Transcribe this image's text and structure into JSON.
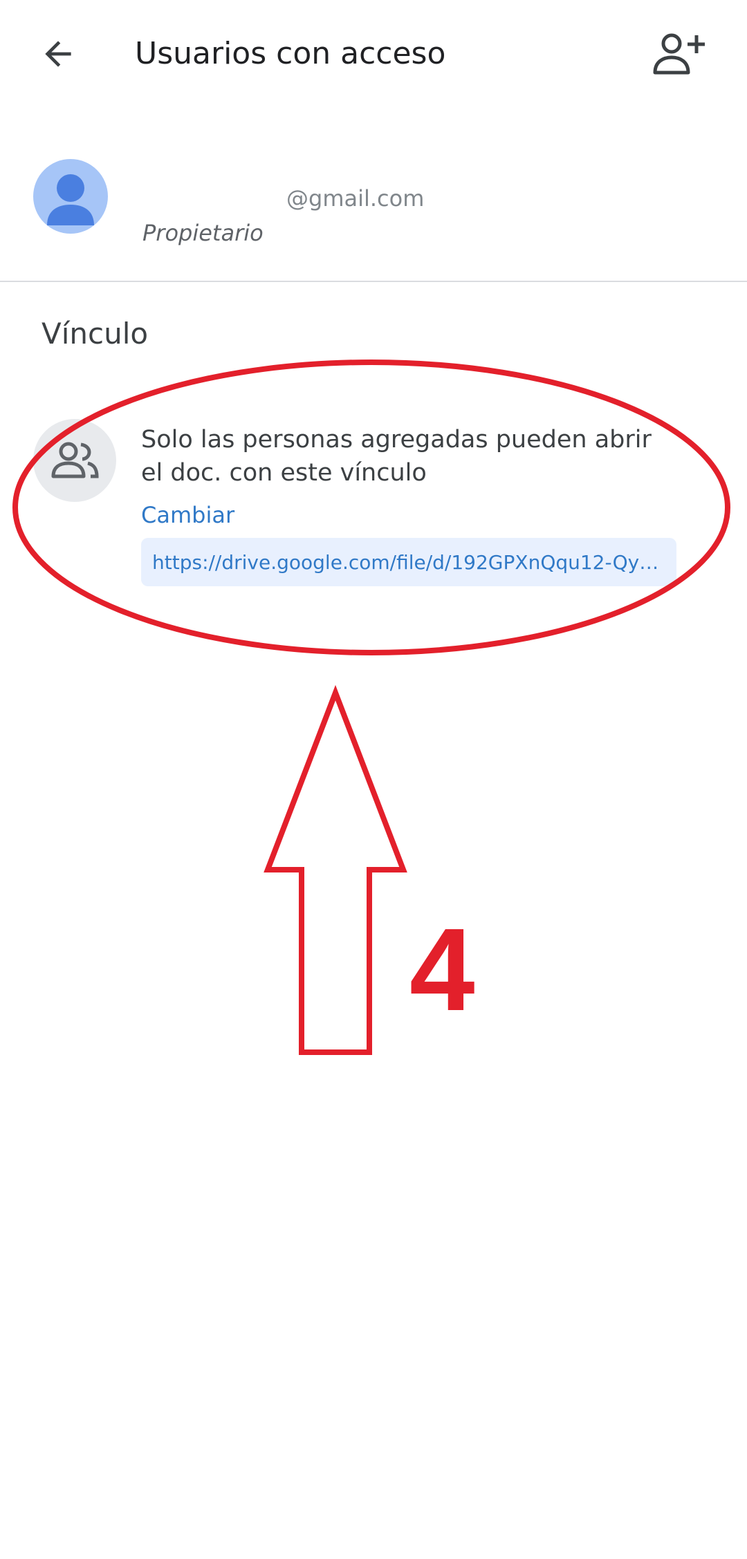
{
  "app_bar": {
    "back_icon": "arrow-left-icon",
    "title": "Usuarios con acceso",
    "add_person_icon": "person-add-icon"
  },
  "owner": {
    "avatar_icon": "person-avatar-icon",
    "email": "@gmail.com",
    "role": "Propietario"
  },
  "link_section": {
    "title": "Vínculo",
    "icon": "people-icon",
    "description": "Solo las personas agregadas pueden abrir el doc. con este vínculo",
    "change_label": "Cambiar",
    "url": "https://drive.google.com/file/d/192GPXnQqu12-Qy0jF9..."
  },
  "annotation": {
    "step_number": "4",
    "color": "#e3202b"
  },
  "colors": {
    "accent": "#3079c7",
    "avatar_bg": "#a6c5f7",
    "avatar_fg": "#4a7fe0",
    "url_bg": "#e8f0fe",
    "icon_circle_bg": "#e8eaed"
  }
}
